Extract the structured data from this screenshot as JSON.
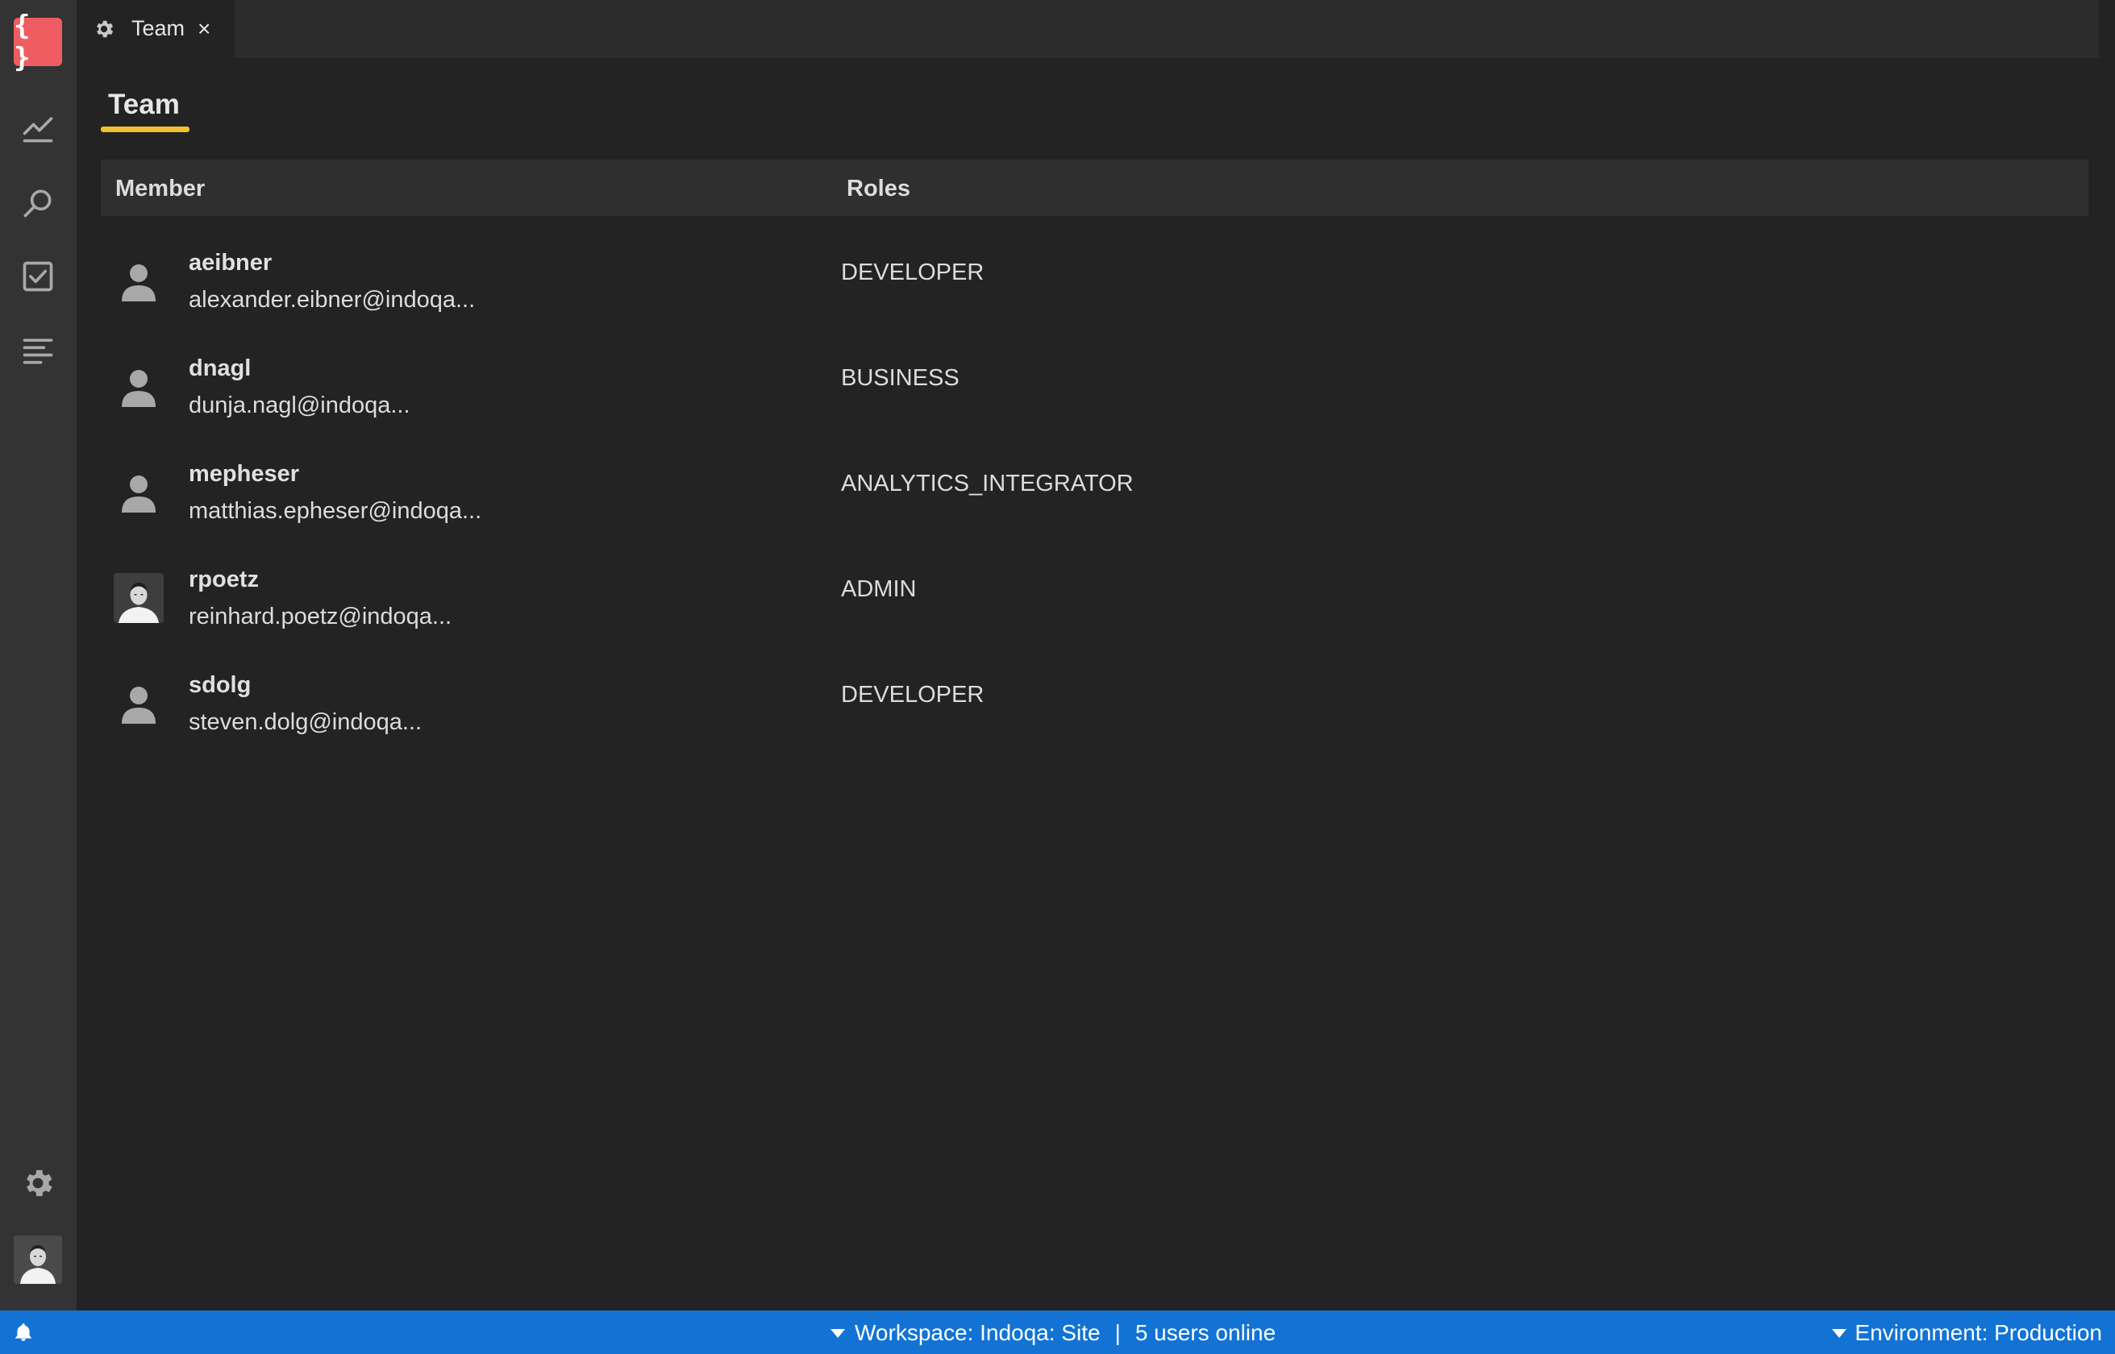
{
  "app": {
    "logo_text": "{ }",
    "accent_color": "#ef5d63",
    "status_bar_color": "#1273d4",
    "title_underline_color": "#f0c030"
  },
  "activity_bar": {
    "items": [
      {
        "icon": "chart-line-icon"
      },
      {
        "icon": "search-icon"
      },
      {
        "icon": "checkbox-icon"
      },
      {
        "icon": "list-icon"
      }
    ],
    "bottom": [
      {
        "icon": "gear-icon"
      },
      {
        "icon": "user-avatar-photo"
      }
    ]
  },
  "tabs": [
    {
      "label": "Team",
      "icon": "gear-icon",
      "close": "×"
    }
  ],
  "page": {
    "title": "Team"
  },
  "table": {
    "headers": {
      "member": "Member",
      "roles": "Roles"
    },
    "rows": [
      {
        "username": "aeibner",
        "email": "alexander.eibner@indoqa...",
        "role": "DEVELOPER",
        "avatar": "default"
      },
      {
        "username": "dnagl",
        "email": "dunja.nagl@indoqa...",
        "role": "BUSINESS",
        "avatar": "default"
      },
      {
        "username": "mepheser",
        "email": "matthias.epheser@indoqa...",
        "role": "ANALYTICS_INTEGRATOR",
        "avatar": "default"
      },
      {
        "username": "rpoetz",
        "email": "reinhard.poetz@indoqa...",
        "role": "ADMIN",
        "avatar": "photo"
      },
      {
        "username": "sdolg",
        "email": "steven.dolg@indoqa...",
        "role": "DEVELOPER",
        "avatar": "default"
      }
    ]
  },
  "status_bar": {
    "workspace": "Workspace: Indoqa: Site",
    "separator": "|",
    "users_online": "5 users online",
    "environment": "Environment: Production"
  }
}
